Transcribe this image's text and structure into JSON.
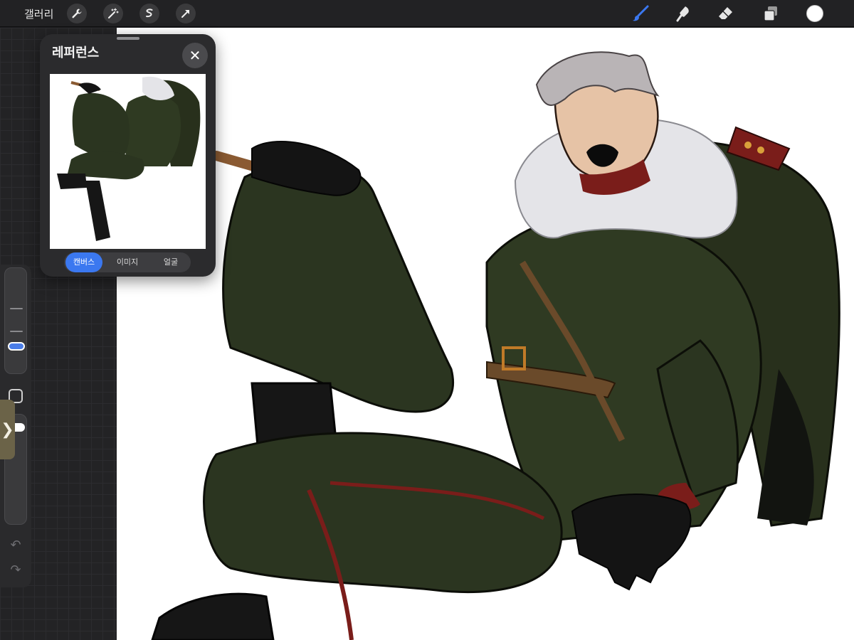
{
  "app": {
    "gallery_label": "갤러리"
  },
  "toolbar": {
    "left_tools": [
      "wrench-icon",
      "magic-wand-icon",
      "selection-icon",
      "transform-arrow-icon"
    ],
    "right_tools": [
      "brush-icon",
      "smudge-icon",
      "eraser-icon",
      "layers-icon"
    ],
    "active_tool": "brush-icon",
    "current_color": "#ffffff",
    "accent_color": "#3b78f0"
  },
  "reference_panel": {
    "title": "레퍼런스",
    "close_symbol": "✕",
    "segments": [
      "캔버스",
      "이미지",
      "얼굴"
    ],
    "active_segment": "캔버스"
  },
  "sidebar": {
    "brush_size_level": 0.25,
    "opacity_level": 0.9,
    "undo_symbol": "↶",
    "redo_symbol": "↷",
    "expand_symbol": "❯"
  }
}
